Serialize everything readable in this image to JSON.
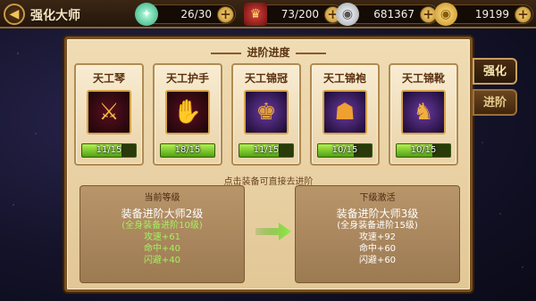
{
  "header": {
    "back_icon": "back-arrow-icon",
    "title": "强化大师"
  },
  "resources": [
    {
      "icon": "jade-crystal-icon",
      "value": "26/30"
    },
    {
      "icon": "medal-icon",
      "value": "73/200"
    },
    {
      "icon": "silver-ingot-icon",
      "value": "681367"
    },
    {
      "icon": "gold-ingot-icon",
      "value": "19199"
    }
  ],
  "panel": {
    "title": "进阶进度",
    "hint": "点击装备可直接去进阶",
    "items": [
      {
        "name": "天工琴",
        "progress_text": "11/15",
        "progress": 0.733,
        "icon": "zither-icon",
        "tint": "red"
      },
      {
        "name": "天工护手",
        "progress_text": "18/15",
        "progress": 1.0,
        "icon": "gauntlet-icon",
        "tint": "red"
      },
      {
        "name": "天工锦冠",
        "progress_text": "11/15",
        "progress": 0.733,
        "icon": "crown-icon",
        "tint": "purple"
      },
      {
        "name": "天工锦袍",
        "progress_text": "10/15",
        "progress": 0.667,
        "icon": "robe-icon",
        "tint": "purple"
      },
      {
        "name": "天工锦靴",
        "progress_text": "10/15",
        "progress": 0.667,
        "icon": "boots-icon",
        "tint": "purple"
      }
    ],
    "current": {
      "header": "当前等级",
      "level": "装备进阶大师2级",
      "requirement": "(全身装备进阶10级)",
      "stats": [
        "攻速+61",
        "命中+40",
        "闪避+40"
      ]
    },
    "next": {
      "header": "下级激活",
      "level": "装备进阶大师3级",
      "requirement": "(全身装备进阶15级)",
      "stats": [
        "攻速+92",
        "命中+60",
        "闪避+60"
      ]
    }
  },
  "tabs": [
    {
      "label": "强化",
      "active": true
    },
    {
      "label": "进阶",
      "active": false
    }
  ],
  "colors": {
    "accent_green": "#a6f060",
    "panel_bg": "#e9d3a8",
    "frame": "#7a5020"
  }
}
